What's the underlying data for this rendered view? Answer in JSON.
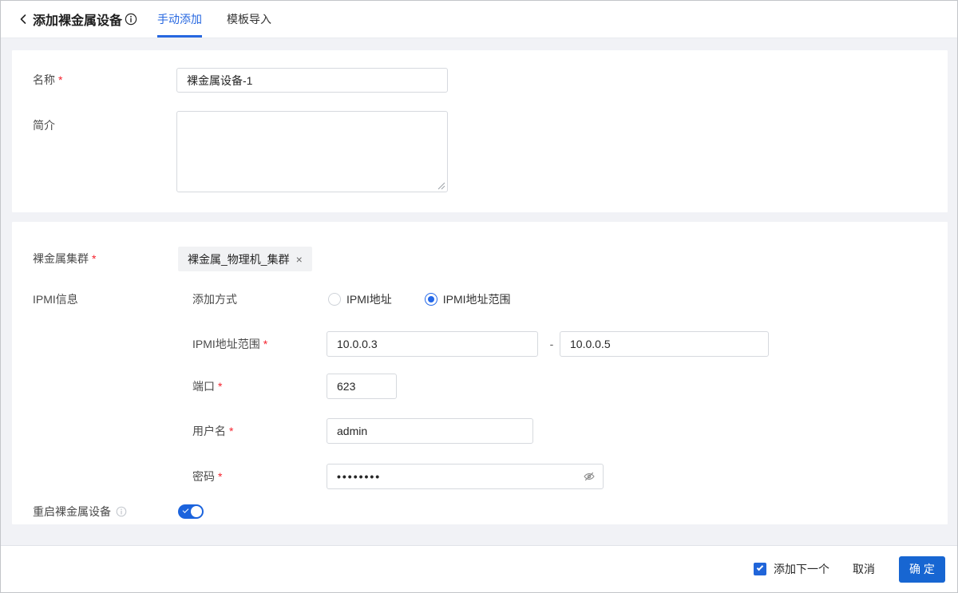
{
  "header": {
    "title": "添加裸金属设备",
    "tabs": [
      {
        "label": "手动添加",
        "active": true
      },
      {
        "label": "模板导入",
        "active": false
      }
    ],
    "back_icon": "chevron-left",
    "title_icon": "info-circle"
  },
  "required_marker": "*",
  "basic_section": {
    "name": {
      "label": "名称",
      "required": true,
      "value": "裸金属设备-1"
    },
    "description": {
      "label": "简介",
      "required": false,
      "value": "",
      "placeholder": ""
    }
  },
  "cluster_section": {
    "cluster": {
      "label": "裸金属集群",
      "required": true,
      "tag": "裸金属_物理机_集群",
      "tag_remove": "×"
    },
    "ipmi": {
      "label": "IPMI信息",
      "add_method": {
        "label": "添加方式",
        "options": [
          {
            "label": "IPMI地址",
            "selected": false
          },
          {
            "label": "IPMI地址范围",
            "selected": true
          }
        ]
      },
      "range": {
        "label": "IPMI地址范围",
        "required": true,
        "start": "10.0.0.3",
        "separator": "-",
        "end": "10.0.0.5"
      },
      "port": {
        "label": "端口",
        "required": true,
        "value": "623"
      },
      "username": {
        "label": "用户名",
        "required": true,
        "value": "admin"
      },
      "password": {
        "label": "密码",
        "required": true,
        "value": "••••••••",
        "visibility_icon": "eye-off",
        "visible": false
      }
    },
    "restart": {
      "label": "重启裸金属设备",
      "info_icon": "info-circle",
      "enabled": true
    }
  },
  "footer": {
    "add_next": {
      "label": "添加下一个",
      "checked": true
    },
    "cancel_label": "取消",
    "confirm_label": "确 定"
  },
  "colors": {
    "primary_button": "#1766d2",
    "active_tab": "#2667e0",
    "toggle_on": "#1b63dd",
    "checkbox": "#2065d9",
    "radio_selected": "#2468e8",
    "required_asterisk": "#f5222d",
    "page_background": "#f1f2f6",
    "card_background": "#ffffff",
    "input_border": "#d6d9de",
    "tag_background": "#f1f2f4"
  }
}
